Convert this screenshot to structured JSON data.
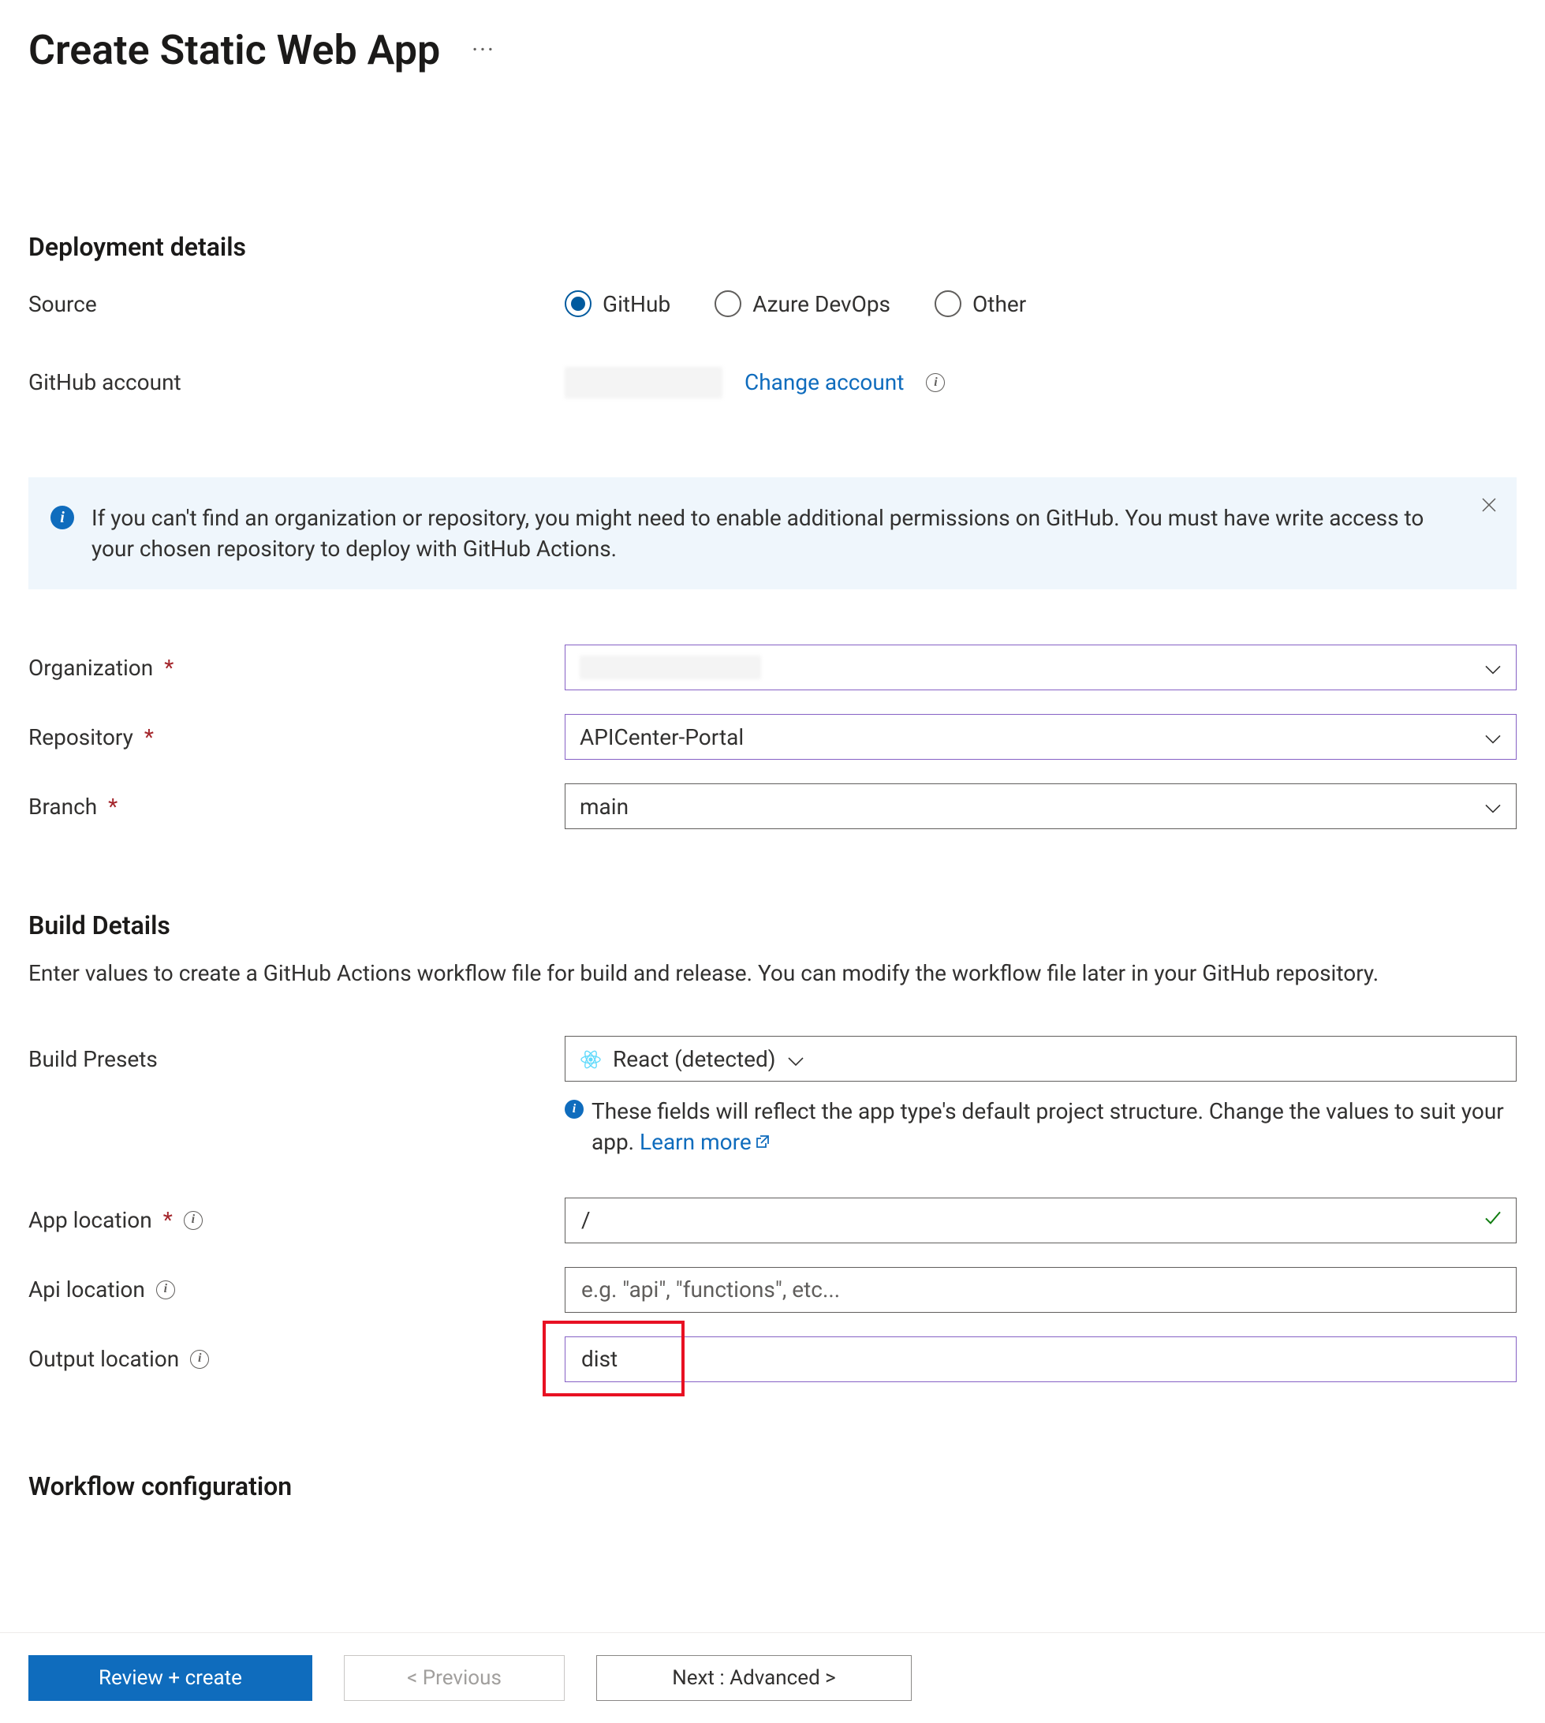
{
  "header": {
    "title": "Create Static Web App"
  },
  "deployment": {
    "section_title": "Deployment details",
    "source_label": "Source",
    "source_options": {
      "github": "GitHub",
      "azure_devops": "Azure DevOps",
      "other": "Other"
    },
    "source_selected": "github",
    "github_account_label": "GitHub account",
    "github_account_value": "",
    "change_account": "Change account"
  },
  "info_banner": {
    "text": "If you can't find an organization or repository, you might need to enable additional permissions on GitHub. You must have write access to your chosen repository to deploy with GitHub Actions."
  },
  "repo": {
    "organization_label": "Organization",
    "organization_value": "",
    "repository_label": "Repository",
    "repository_value": "APICenter-Portal",
    "branch_label": "Branch",
    "branch_value": "main"
  },
  "build": {
    "section_title": "Build Details",
    "section_desc": "Enter values to create a GitHub Actions workflow file for build and release. You can modify the workflow file later in your GitHub repository.",
    "presets_label": "Build Presets",
    "presets_value": "React (detected)",
    "hint_text": "These fields will reflect the app type's default project structure. Change the values to suit your app. ",
    "learn_more": "Learn more",
    "app_location_label": "App location",
    "app_location_value": "/",
    "api_location_label": "Api location",
    "api_location_placeholder": "e.g. \"api\", \"functions\", etc...",
    "api_location_value": "",
    "output_location_label": "Output location",
    "output_location_value": "dist"
  },
  "workflow": {
    "section_title": "Workflow configuration"
  },
  "footer": {
    "review_create": "Review + create",
    "previous": "< Previous",
    "next": "Next : Advanced >"
  }
}
